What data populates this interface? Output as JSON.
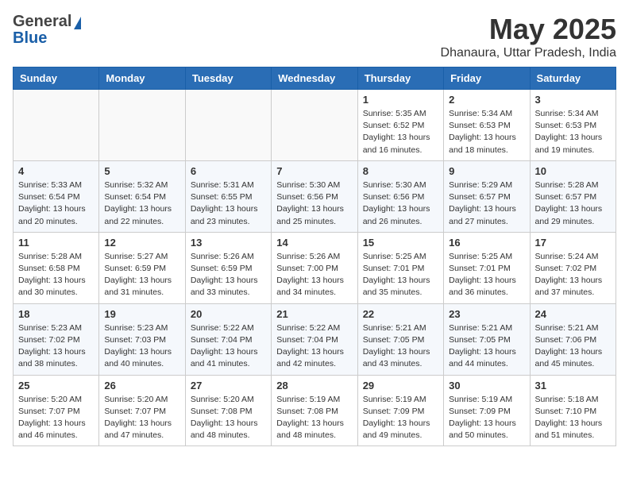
{
  "header": {
    "logo_general": "General",
    "logo_blue": "Blue",
    "title": "May 2025",
    "location": "Dhanaura, Uttar Pradesh, India"
  },
  "days_of_week": [
    "Sunday",
    "Monday",
    "Tuesday",
    "Wednesday",
    "Thursday",
    "Friday",
    "Saturday"
  ],
  "weeks": [
    [
      {
        "day": "",
        "info": ""
      },
      {
        "day": "",
        "info": ""
      },
      {
        "day": "",
        "info": ""
      },
      {
        "day": "",
        "info": ""
      },
      {
        "day": "1",
        "info": "Sunrise: 5:35 AM\nSunset: 6:52 PM\nDaylight: 13 hours\nand 16 minutes."
      },
      {
        "day": "2",
        "info": "Sunrise: 5:34 AM\nSunset: 6:53 PM\nDaylight: 13 hours\nand 18 minutes."
      },
      {
        "day": "3",
        "info": "Sunrise: 5:34 AM\nSunset: 6:53 PM\nDaylight: 13 hours\nand 19 minutes."
      }
    ],
    [
      {
        "day": "4",
        "info": "Sunrise: 5:33 AM\nSunset: 6:54 PM\nDaylight: 13 hours\nand 20 minutes."
      },
      {
        "day": "5",
        "info": "Sunrise: 5:32 AM\nSunset: 6:54 PM\nDaylight: 13 hours\nand 22 minutes."
      },
      {
        "day": "6",
        "info": "Sunrise: 5:31 AM\nSunset: 6:55 PM\nDaylight: 13 hours\nand 23 minutes."
      },
      {
        "day": "7",
        "info": "Sunrise: 5:30 AM\nSunset: 6:56 PM\nDaylight: 13 hours\nand 25 minutes."
      },
      {
        "day": "8",
        "info": "Sunrise: 5:30 AM\nSunset: 6:56 PM\nDaylight: 13 hours\nand 26 minutes."
      },
      {
        "day": "9",
        "info": "Sunrise: 5:29 AM\nSunset: 6:57 PM\nDaylight: 13 hours\nand 27 minutes."
      },
      {
        "day": "10",
        "info": "Sunrise: 5:28 AM\nSunset: 6:57 PM\nDaylight: 13 hours\nand 29 minutes."
      }
    ],
    [
      {
        "day": "11",
        "info": "Sunrise: 5:28 AM\nSunset: 6:58 PM\nDaylight: 13 hours\nand 30 minutes."
      },
      {
        "day": "12",
        "info": "Sunrise: 5:27 AM\nSunset: 6:59 PM\nDaylight: 13 hours\nand 31 minutes."
      },
      {
        "day": "13",
        "info": "Sunrise: 5:26 AM\nSunset: 6:59 PM\nDaylight: 13 hours\nand 33 minutes."
      },
      {
        "day": "14",
        "info": "Sunrise: 5:26 AM\nSunset: 7:00 PM\nDaylight: 13 hours\nand 34 minutes."
      },
      {
        "day": "15",
        "info": "Sunrise: 5:25 AM\nSunset: 7:01 PM\nDaylight: 13 hours\nand 35 minutes."
      },
      {
        "day": "16",
        "info": "Sunrise: 5:25 AM\nSunset: 7:01 PM\nDaylight: 13 hours\nand 36 minutes."
      },
      {
        "day": "17",
        "info": "Sunrise: 5:24 AM\nSunset: 7:02 PM\nDaylight: 13 hours\nand 37 minutes."
      }
    ],
    [
      {
        "day": "18",
        "info": "Sunrise: 5:23 AM\nSunset: 7:02 PM\nDaylight: 13 hours\nand 38 minutes."
      },
      {
        "day": "19",
        "info": "Sunrise: 5:23 AM\nSunset: 7:03 PM\nDaylight: 13 hours\nand 40 minutes."
      },
      {
        "day": "20",
        "info": "Sunrise: 5:22 AM\nSunset: 7:04 PM\nDaylight: 13 hours\nand 41 minutes."
      },
      {
        "day": "21",
        "info": "Sunrise: 5:22 AM\nSunset: 7:04 PM\nDaylight: 13 hours\nand 42 minutes."
      },
      {
        "day": "22",
        "info": "Sunrise: 5:21 AM\nSunset: 7:05 PM\nDaylight: 13 hours\nand 43 minutes."
      },
      {
        "day": "23",
        "info": "Sunrise: 5:21 AM\nSunset: 7:05 PM\nDaylight: 13 hours\nand 44 minutes."
      },
      {
        "day": "24",
        "info": "Sunrise: 5:21 AM\nSunset: 7:06 PM\nDaylight: 13 hours\nand 45 minutes."
      }
    ],
    [
      {
        "day": "25",
        "info": "Sunrise: 5:20 AM\nSunset: 7:07 PM\nDaylight: 13 hours\nand 46 minutes."
      },
      {
        "day": "26",
        "info": "Sunrise: 5:20 AM\nSunset: 7:07 PM\nDaylight: 13 hours\nand 47 minutes."
      },
      {
        "day": "27",
        "info": "Sunrise: 5:20 AM\nSunset: 7:08 PM\nDaylight: 13 hours\nand 48 minutes."
      },
      {
        "day": "28",
        "info": "Sunrise: 5:19 AM\nSunset: 7:08 PM\nDaylight: 13 hours\nand 48 minutes."
      },
      {
        "day": "29",
        "info": "Sunrise: 5:19 AM\nSunset: 7:09 PM\nDaylight: 13 hours\nand 49 minutes."
      },
      {
        "day": "30",
        "info": "Sunrise: 5:19 AM\nSunset: 7:09 PM\nDaylight: 13 hours\nand 50 minutes."
      },
      {
        "day": "31",
        "info": "Sunrise: 5:18 AM\nSunset: 7:10 PM\nDaylight: 13 hours\nand 51 minutes."
      }
    ]
  ]
}
